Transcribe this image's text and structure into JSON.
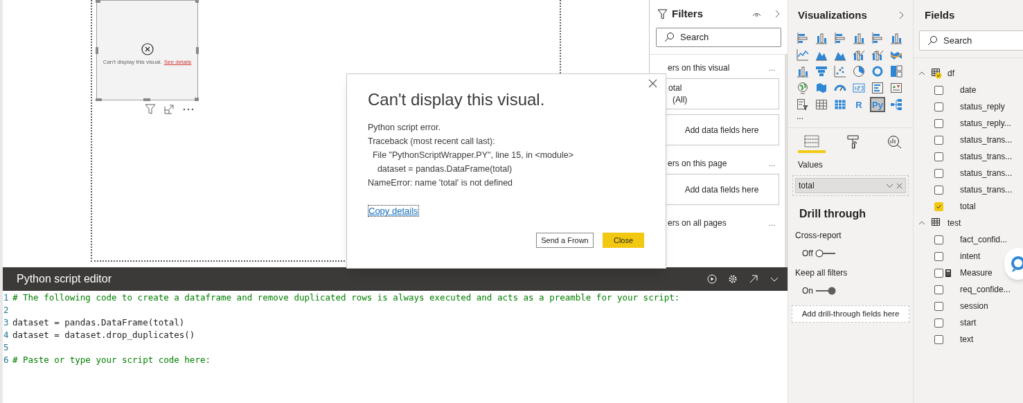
{
  "canvas": {
    "visual": {
      "message": "Can't display this visual.",
      "link": "See details"
    }
  },
  "dialog": {
    "title": "Can't display this visual.",
    "lines": [
      "Python script error.",
      "Traceback (most recent call last):",
      "  File \"PythonScriptWrapper.PY\", line 15, in <module>",
      "    dataset = pandas.DataFrame(total)",
      "NameError: name 'total' is not defined"
    ],
    "link": "Copy details",
    "buttons": [
      {
        "label": "Send a Frown",
        "kind": "secondary"
      },
      {
        "label": "Close",
        "kind": "primary"
      }
    ]
  },
  "filters": {
    "title": "Filters",
    "search_placeholder": "Search",
    "sections": [
      {
        "title": "ers on this visual",
        "more": "...",
        "cards": [
          {
            "kind": "filter",
            "name": "otal",
            "value": "(All)"
          },
          {
            "kind": "drop",
            "label": "Add data fields here"
          }
        ]
      },
      {
        "title": "ers on this page",
        "more": "...",
        "cards": [
          {
            "kind": "drop",
            "label": "Add data fields here"
          }
        ]
      },
      {
        "title": "ers on all pages",
        "more": "..."
      }
    ]
  },
  "editor": {
    "title": "Python script editor",
    "lines": [
      {
        "number": "1",
        "code": "# The following code to create a dataframe and remove duplicated rows is always executed and acts as a preamble for your script:",
        "kind": "comment"
      },
      {
        "number": "2"
      },
      {
        "number": "3",
        "code": "dataset = pandas.DataFrame(total)",
        "kind": "code"
      },
      {
        "number": "4",
        "code": "dataset = dataset.drop_duplicates()",
        "kind": "code"
      },
      {
        "number": "5"
      },
      {
        "number": "6",
        "code": "# Paste or type your script code here:",
        "kind": "comment"
      }
    ]
  },
  "visualizations": {
    "title": "Visualizations",
    "types": [
      {
        "kind": "hbar",
        "selected": false
      },
      {
        "kind": "vbar",
        "selected": false
      },
      {
        "kind": "hbar",
        "selected": false
      },
      {
        "kind": "vbar",
        "selected": false
      },
      {
        "kind": "hbar",
        "selected": false
      },
      {
        "kind": "vbar",
        "selected": false
      },
      {
        "kind": "line",
        "selected": false
      },
      {
        "kind": "area",
        "selected": false
      },
      {
        "kind": "area",
        "selected": false
      },
      {
        "kind": "combo",
        "selected": false
      },
      {
        "kind": "combo",
        "selected": false
      },
      {
        "kind": "ribbon",
        "selected": false
      },
      {
        "kind": "vbar",
        "selected": false
      },
      {
        "kind": "funnel",
        "selected": false
      },
      {
        "kind": "scatter",
        "selected": false
      },
      {
        "kind": "pie",
        "selected": false
      },
      {
        "kind": "donut",
        "selected": false
      },
      {
        "kind": "treemap",
        "selected": false
      },
      {
        "kind": "globe",
        "selected": false
      },
      {
        "kind": "map",
        "selected": false
      },
      {
        "kind": "gauge",
        "selected": false
      },
      {
        "kind": "card",
        "selected": false
      },
      {
        "kind": "list",
        "selected": false
      },
      {
        "kind": "kpi",
        "selected": false
      },
      {
        "kind": "slicer",
        "selected": false
      },
      {
        "kind": "table",
        "selected": false
      },
      {
        "kind": "matrix",
        "selected": false
      },
      {
        "kind": "text",
        "label": "R",
        "selected": false
      },
      {
        "kind": "text",
        "label": "Py",
        "selected": true
      },
      {
        "kind": "tree",
        "selected": false
      }
    ],
    "more": "...",
    "tabs": [
      {
        "kind": "fields",
        "selected": true
      },
      {
        "kind": "format",
        "selected": false
      },
      {
        "kind": "analytics",
        "selected": false
      }
    ],
    "values_label": "Values",
    "value_field": "total",
    "drill_through": {
      "title": "Drill through",
      "options": [
        {
          "label": "Cross-report",
          "state_label": "Off",
          "on": false
        },
        {
          "label": "Keep all filters",
          "state_label": "On",
          "on": true
        }
      ],
      "drop": "Add drill-through fields here"
    }
  },
  "fields": {
    "title": "Fields",
    "search_placeholder": "Search",
    "tables": [
      {
        "name": "df",
        "expanded": true,
        "checked": true,
        "children": [
          {
            "name": "date",
            "kind": "column",
            "checked": false
          },
          {
            "name": "status_reply",
            "kind": "column",
            "checked": false
          },
          {
            "name": "status_reply...",
            "kind": "column",
            "checked": false
          },
          {
            "name": "status_trans...",
            "kind": "column",
            "checked": false
          },
          {
            "name": "status_trans...",
            "kind": "column",
            "checked": false
          },
          {
            "name": "status_trans...",
            "kind": "column",
            "checked": false
          },
          {
            "name": "status_trans...",
            "kind": "column",
            "checked": false
          },
          {
            "name": "total",
            "kind": "column",
            "checked": true
          }
        ]
      },
      {
        "name": "test",
        "expanded": true,
        "checked": false,
        "children": [
          {
            "name": "fact_confid...",
            "kind": "column",
            "checked": false
          },
          {
            "name": "intent",
            "kind": "column",
            "checked": false
          },
          {
            "name": "Measure",
            "kind": "measure",
            "checked": false
          },
          {
            "name": "req_confide...",
            "kind": "column",
            "checked": false
          },
          {
            "name": "session",
            "kind": "column",
            "checked": false
          },
          {
            "name": "start",
            "kind": "column",
            "checked": false
          },
          {
            "name": "text",
            "kind": "column",
            "checked": false
          }
        ]
      }
    ]
  }
}
